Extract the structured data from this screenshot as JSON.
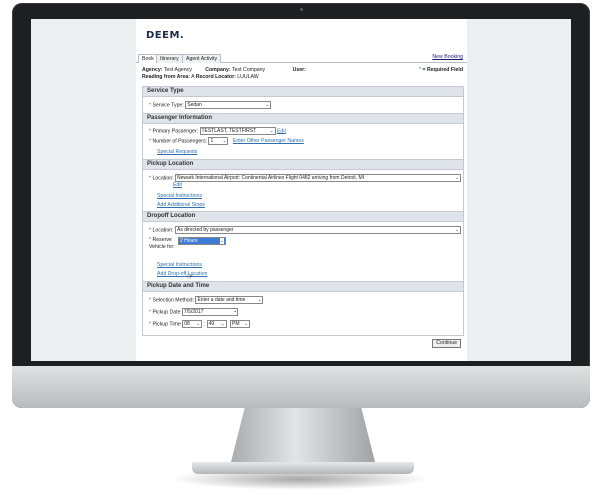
{
  "logo": {
    "text": "DEEM",
    "suffix": "."
  },
  "tabs": [
    {
      "label": "Book"
    },
    {
      "label": "Itinerary"
    },
    {
      "label": "Agent Activity"
    }
  ],
  "header": {
    "new_booking": "New Booking"
  },
  "info": {
    "agency_label": "Agency:",
    "agency_value": "Test Agency",
    "company_label": "Company:",
    "company_value": "Test Company",
    "user_label": "User:",
    "area_label": "Reading from Area:",
    "area_value": "A",
    "locator_label": "Record Locator:",
    "locator_value": "LUULAW",
    "required_star": "*",
    "required_text": "= Required Field"
  },
  "service_type": {
    "title": "Service Type",
    "label": "Service Type:",
    "value": "Sedan"
  },
  "passenger": {
    "title": "Passenger Information",
    "primary_label": "Primary Passenger:",
    "primary_value": "TESTLAST, TESTFIRST",
    "edit_link": "Edit",
    "count_label": "Number of Passengers:",
    "count_value": "1",
    "other_names_link": "Enter Other Passenger Names",
    "special_requests_link": "Special Requests"
  },
  "pickup_location": {
    "title": "Pickup Location",
    "label": "Location:",
    "value": "Newark International Airport: Continental Airlines Flight 0482 arriving from Detroit, MI",
    "edit_link": "Edit",
    "special_instructions_link": "Special Instructions",
    "add_stops_link": "Add Additional Stops"
  },
  "dropoff_location": {
    "title": "Dropoff Location",
    "label": "Location:",
    "value": "As directed by passenger",
    "reserve_label": "Reserve Vehicle for:",
    "reserve_value": "2 Hours",
    "special_instructions_link": "Special Instructions",
    "add_dropoff_link": "Add Drop-off Location"
  },
  "pickup_datetime": {
    "title": "Pickup Date and Time",
    "method_label": "Selection Method:",
    "method_value": "Enter a date and time",
    "date_label": "Pickup Date",
    "date_value": "7/5/2017",
    "time_label": "Pickup Time",
    "hour_value": "08",
    "minute_value": "49",
    "ampm_value": "PM",
    "time_sep": ":"
  },
  "continue_button": "Continue"
}
